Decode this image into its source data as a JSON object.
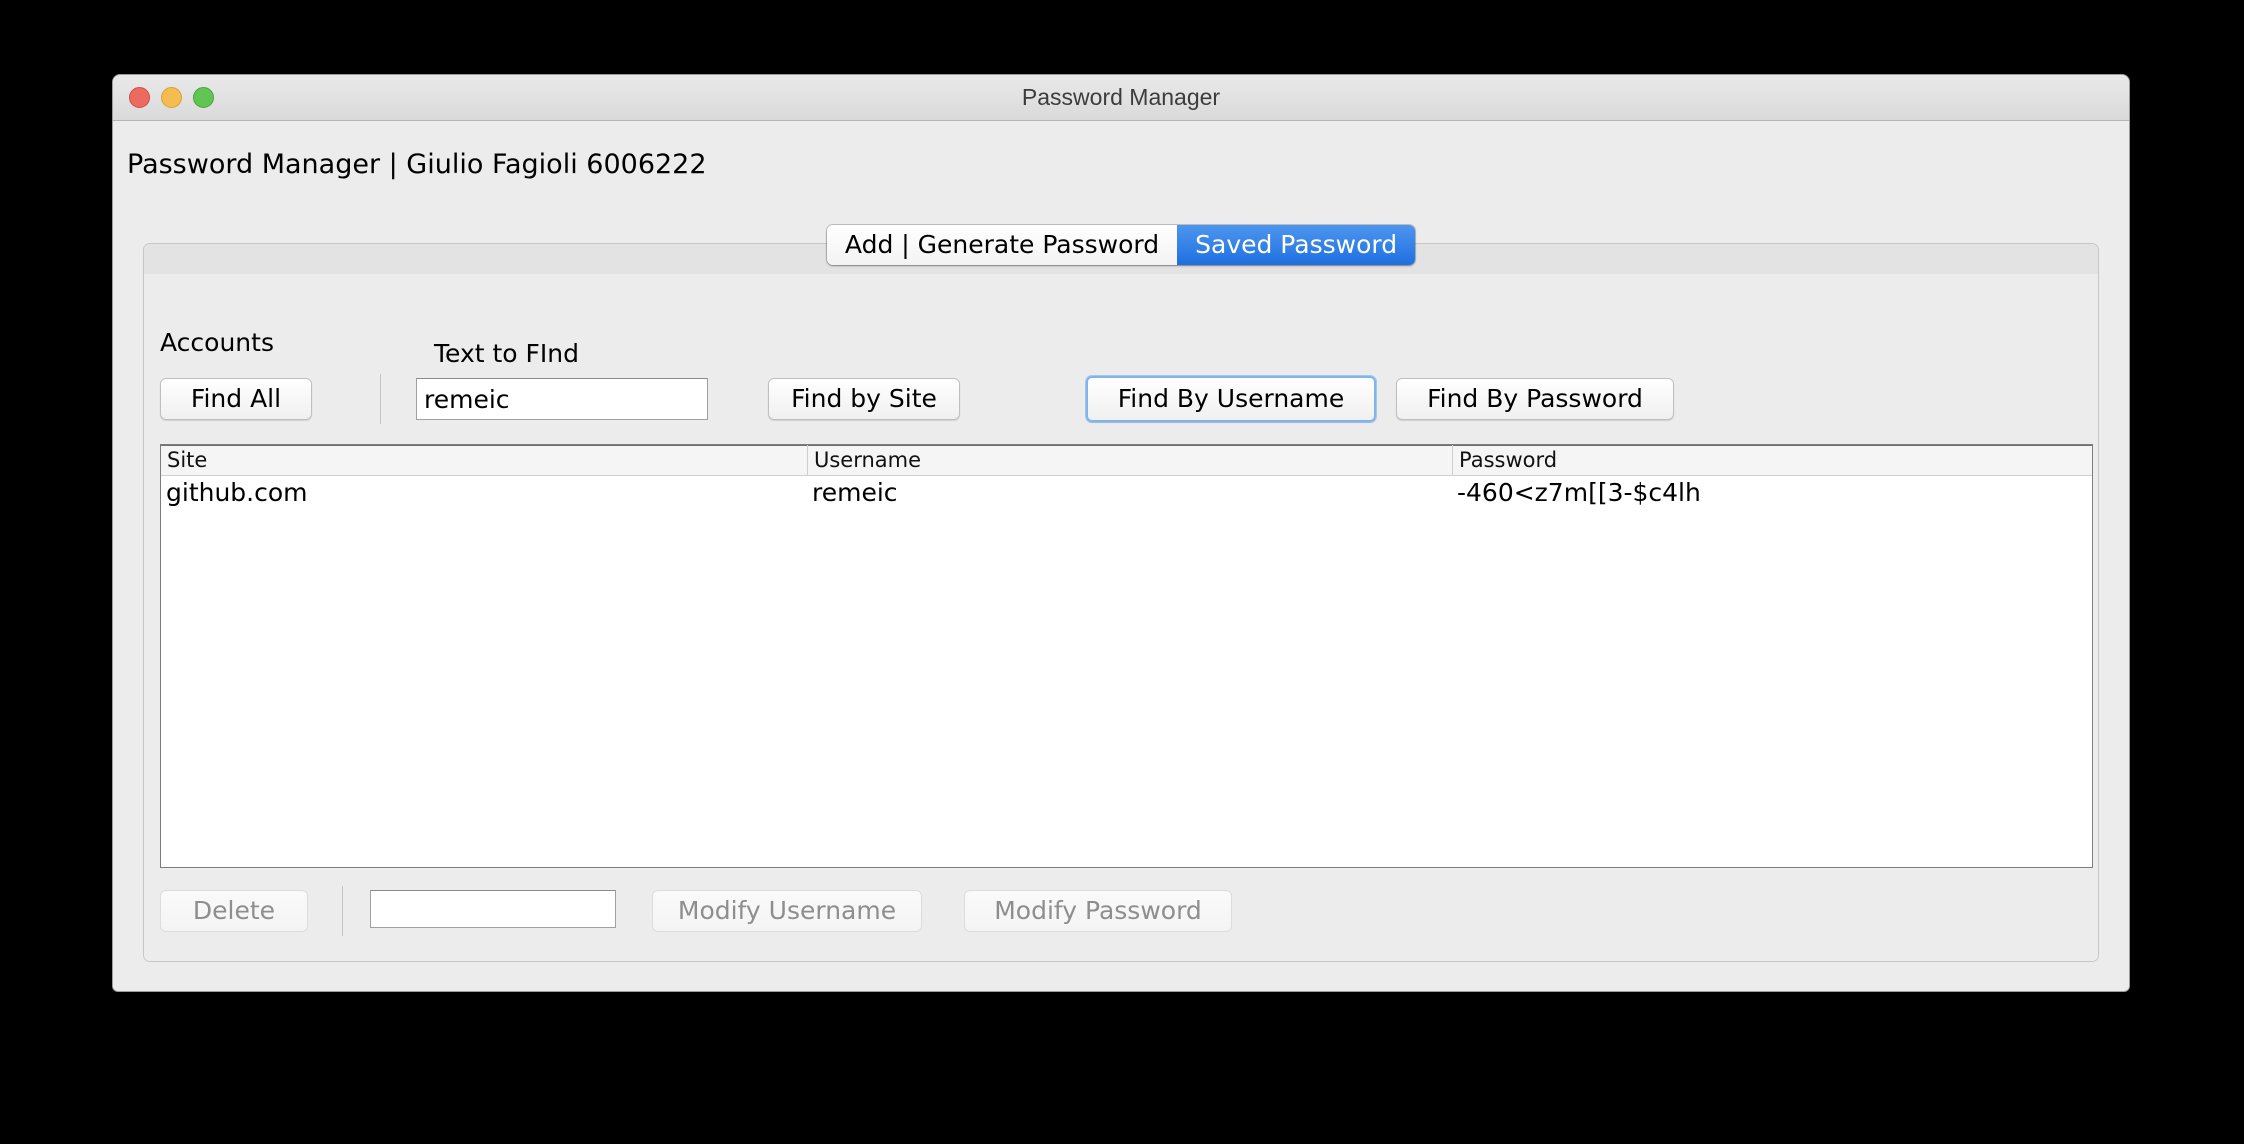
{
  "window": {
    "title": "Password Manager",
    "controls": {
      "close": "close-button",
      "minimize": "minimize-button",
      "maximize": "maximize-button"
    }
  },
  "app": {
    "header": "Password Manager | Giulio Fagioli 6006222"
  },
  "tabs": [
    {
      "label": "Add | Generate Password",
      "active": false
    },
    {
      "label": "Saved Password",
      "active": true
    }
  ],
  "labels": {
    "accounts": "Accounts",
    "text_to_find": "Text to FInd"
  },
  "search": {
    "find_all": "Find All",
    "input_value": "remeic",
    "input_placeholder": "",
    "find_by_site": "Find by Site",
    "find_by_username": "Find By Username",
    "find_by_password": "Find By Password"
  },
  "table": {
    "columns": [
      "Site",
      "Username",
      "Password"
    ],
    "rows": [
      {
        "site": "github.com",
        "username": "remeic",
        "password": "-460<z7m[[3-$c4lh"
      }
    ]
  },
  "footer": {
    "delete": "Delete",
    "modify_input_value": "",
    "modify_input_placeholder": "",
    "modify_username": "Modify Username",
    "modify_password": "Modify Password"
  },
  "colors": {
    "accent_blue": "#1f6fe0",
    "focus_ring": "#7fb4ec",
    "window_bg": "#ececec",
    "table_bg": "#ffffff",
    "disabled_text": "#8e8e8e"
  }
}
